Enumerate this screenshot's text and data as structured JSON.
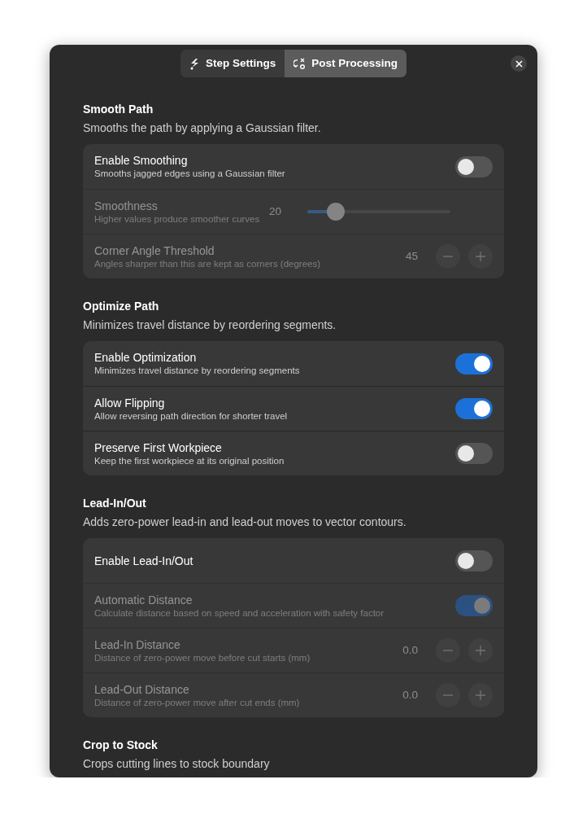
{
  "tabs": [
    {
      "label": "Step Settings",
      "selected": false
    },
    {
      "label": "Post Processing",
      "selected": true
    }
  ],
  "sections": [
    {
      "title": "Smooth Path",
      "description": "Smooths the path by applying a Gaussian filter.",
      "rows": [
        {
          "kind": "switch",
          "title": "Enable Smoothing",
          "subtitle": "Smooths jagged edges using a Gaussian filter",
          "disabled": false,
          "on": false
        },
        {
          "kind": "slider",
          "title": "Smoothness",
          "subtitle": "Higher values produce smoother curves",
          "disabled": true,
          "value": "20",
          "level": 0.2
        },
        {
          "kind": "spin",
          "title": "Corner Angle Threshold",
          "subtitle": "Angles sharper than this are kept as corners (degrees)",
          "disabled": true,
          "value": "45"
        }
      ]
    },
    {
      "title": "Optimize Path",
      "description": "Minimizes travel distance by reordering segments.",
      "rows": [
        {
          "kind": "switch",
          "title": "Enable Optimization",
          "subtitle": "Minimizes travel distance by reordering segments",
          "disabled": false,
          "on": true
        },
        {
          "kind": "switch",
          "title": "Allow Flipping",
          "subtitle": "Allow reversing path direction for shorter travel",
          "disabled": false,
          "on": true
        },
        {
          "kind": "switch",
          "title": "Preserve First Workpiece",
          "subtitle": "Keep the first workpiece at its original position",
          "disabled": false,
          "on": false
        }
      ]
    },
    {
      "title": "Lead-In/Out",
      "description": "Adds zero-power lead-in and lead-out moves to vector contours.",
      "rows": [
        {
          "kind": "switch",
          "title": "Enable Lead-In/Out",
          "disabled": false,
          "on": false
        },
        {
          "kind": "switch",
          "title": "Automatic Distance",
          "subtitle": "Calculate distance based on speed and acceleration with safety factor",
          "disabled": true,
          "on": true
        },
        {
          "kind": "spin",
          "title": "Lead-In Distance",
          "subtitle": "Distance of zero-power move before cut starts (mm)",
          "disabled": true,
          "value": "0.0"
        },
        {
          "kind": "spin",
          "title": "Lead-Out Distance",
          "subtitle": "Distance of zero-power move after cut ends (mm)",
          "disabled": true,
          "value": "0.0"
        }
      ]
    },
    {
      "title": "Crop to Stock",
      "description": "Crops cutting lines to stock boundary"
    }
  ]
}
